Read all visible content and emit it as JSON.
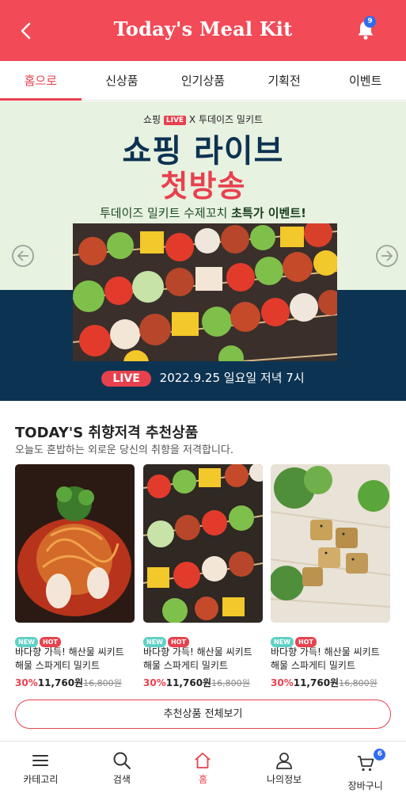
{
  "header": {
    "title": "Today's Meal Kit",
    "notification_count": "9"
  },
  "tabs": [
    {
      "label": "홈으로",
      "active": true
    },
    {
      "label": "신상품"
    },
    {
      "label": "인기상품"
    },
    {
      "label": "기획전"
    },
    {
      "label": "이벤트"
    }
  ],
  "banner": {
    "top_prefix": "쇼핑",
    "top_live": "LIVE",
    "top_suffix": "X 투데이즈 밀키트",
    "headline1": "쇼핑 라이브",
    "headline2": "첫방송",
    "sub_normal": "투데이즈 밀키트 수제꼬치",
    "sub_bold": "초특가 이벤트!",
    "live_label": "LIVE",
    "schedule": "2022.9.25  일요일 저녁 7시"
  },
  "recommend": {
    "title": "TODAY'S 취향저격 추천상품",
    "subtitle": "오늘도 혼밥하는 외로운 당신의 취향을 저격합니다.",
    "items": [
      {
        "badge_new": "NEW",
        "badge_hot": "HOT",
        "name": "바다향 가득! 해산물 씨키트 해물 스파게티 밀키트",
        "discount": "30%",
        "price": "11,760원",
        "original": "16,800원",
        "image": "seafood-spaghetti"
      },
      {
        "badge_new": "NEW",
        "badge_hot": "HOT",
        "name": "바다향 가득! 해산물 씨키트 해물 스파게티 밀키트",
        "discount": "30%",
        "price": "11,760원",
        "original": "16,800원",
        "image": "skewers"
      },
      {
        "badge_new": "NEW",
        "badge_hot": "HOT",
        "name": "바다향 가득! 해산물 씨키트 해물 스파게티 밀키트",
        "discount": "30%",
        "price": "11,760원",
        "original": "16,800원",
        "image": "tofu-noodles"
      }
    ],
    "more_button": "추천상품 전체보기"
  },
  "bottom_nav": {
    "items": [
      {
        "label": "카테고리",
        "icon": "menu-icon"
      },
      {
        "label": "검색",
        "icon": "search-icon"
      },
      {
        "label": "홈",
        "icon": "home-icon",
        "active": true
      },
      {
        "label": "나의정보",
        "icon": "user-icon"
      },
      {
        "label": "장바구니",
        "icon": "cart-icon"
      }
    ],
    "cart_count": "6"
  },
  "colors": {
    "brand_red": "#f24a57",
    "navy": "#0d3352",
    "mint": "#e8f2e1",
    "badge_blue": "#2f6cf0"
  }
}
